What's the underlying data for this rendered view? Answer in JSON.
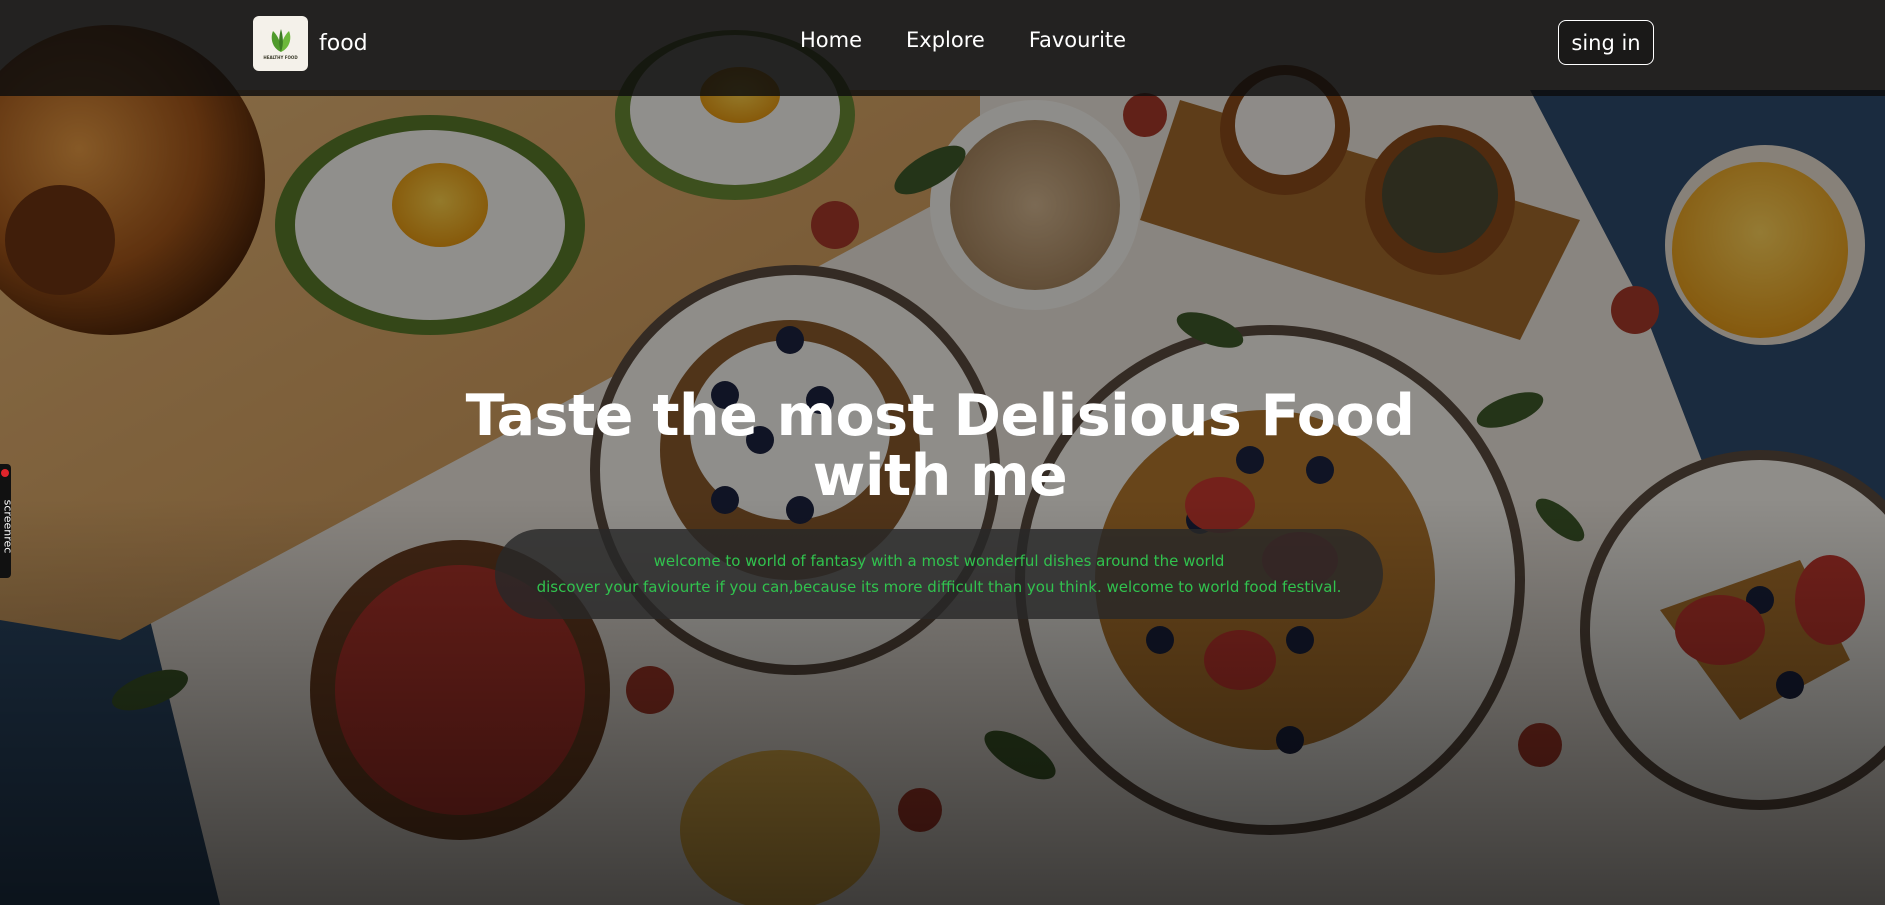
{
  "brand": {
    "logo_text": "HEALTHY FOOD",
    "name": "food"
  },
  "nav": {
    "items": [
      "Home",
      "Explore",
      "Favourite"
    ],
    "signin_label": "sing in"
  },
  "hero": {
    "title": "Taste the most Delisious Food with me",
    "line1": "welcome to world of fantasy with a most wonderful dishes around the world",
    "line2": "discover your faviourte if you can,because its more difficult than you think. welcome to world food festival.",
    "accent_color": "#31c24e"
  },
  "recorder": {
    "label": "screenrec"
  }
}
